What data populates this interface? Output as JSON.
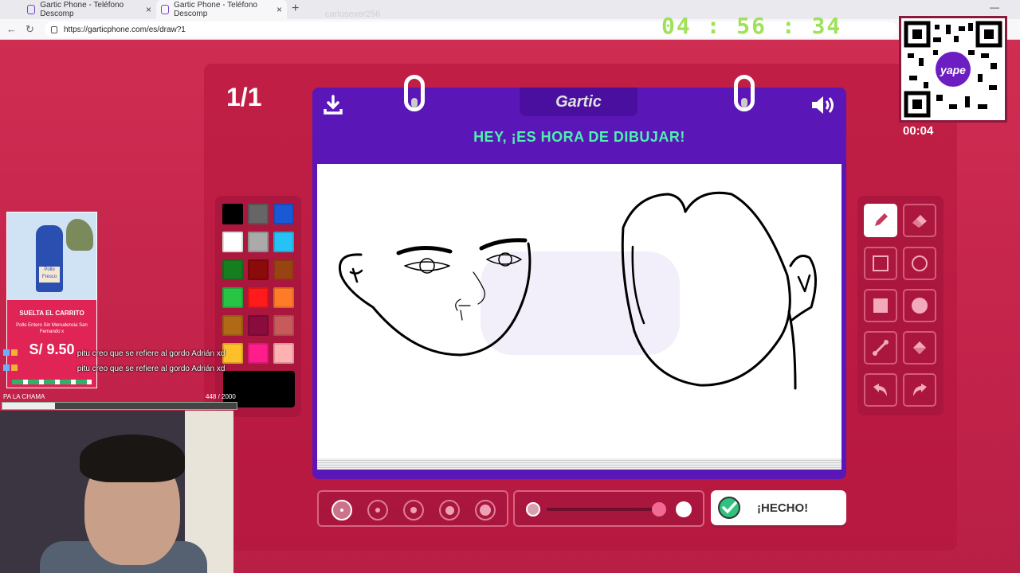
{
  "browser": {
    "tabs": [
      {
        "title": "Gartic Phone - Teléfono Descomp"
      },
      {
        "title": "Gartic Phone - Teléfono Descomp"
      }
    ],
    "url": "https://garticphone.com/es/draw?1"
  },
  "overlay": {
    "username": "carlosever256",
    "timer": "04 : 56 : 34",
    "qr_timer": "00:04",
    "qr_brand": "yape"
  },
  "game": {
    "round": "1/1",
    "logo": "Gartic",
    "prompt": "HEY, ¡ES HORA DE DIBUJAR!",
    "done_label": "¡HECHO!",
    "palette": [
      "#000000",
      "#666666",
      "#1a59d6",
      "#ffffff",
      "#aaaaaa",
      "#27c2f5",
      "#157f1f",
      "#8b0a0a",
      "#9a4312",
      "#28c443",
      "#ff1b1b",
      "#ff7b27",
      "#b06a16",
      "#8a0c3d",
      "#c95a5c",
      "#fec02a",
      "#ff1d8b",
      "#ffb1b1"
    ],
    "selected_color": "#000000",
    "tools": [
      {
        "name": "pencil-icon",
        "active": true
      },
      {
        "name": "eraser-icon",
        "active": false
      },
      {
        "name": "rectangle-outline-icon",
        "active": false
      },
      {
        "name": "ellipse-outline-icon",
        "active": false
      },
      {
        "name": "rectangle-filled-icon",
        "active": false
      },
      {
        "name": "ellipse-filled-icon",
        "active": false
      },
      {
        "name": "line-icon",
        "active": false
      },
      {
        "name": "fill-bucket-icon",
        "active": false
      },
      {
        "name": "undo-icon",
        "active": false
      },
      {
        "name": "redo-icon",
        "active": false
      }
    ],
    "brush_sizes": 5,
    "selected_size_index": 0,
    "opacity_level": 1.0
  },
  "stream": {
    "ad": {
      "title": "SUELTA EL CARRITO",
      "subtitle": "Pollo Entero Sin Menudencia San Fernando x",
      "price": "S/ 9.50",
      "product_label": "Pollo Fresco"
    },
    "chat": [
      {
        "text": "pitu creo que se refiere al gordo Adrián xd"
      },
      {
        "text": "pitu creo que se refiere al gordo Adrián xd"
      }
    ],
    "goal": {
      "label": "PA LA CHAMA",
      "count": "448 / 2000",
      "progress": 0.224
    }
  }
}
